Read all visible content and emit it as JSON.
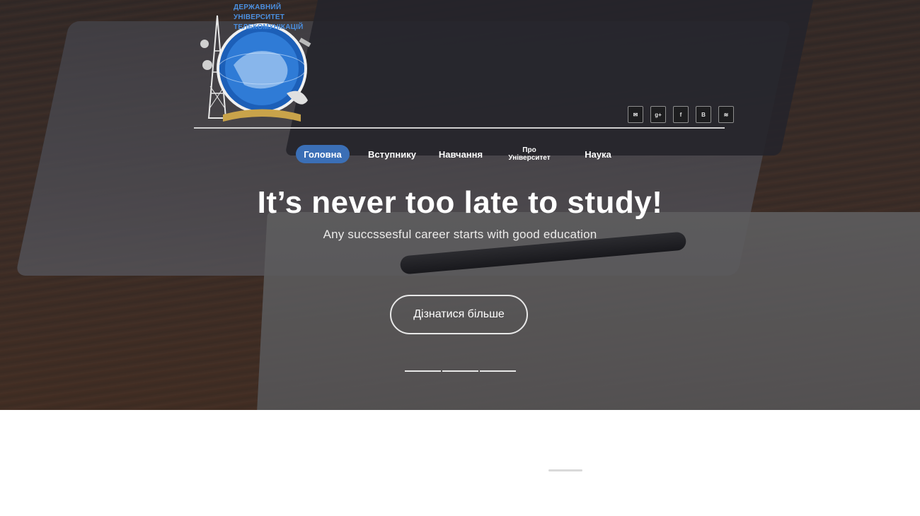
{
  "logo": {
    "lines": [
      "ДЕРЖАВНИЙ",
      "УНІВЕРСИТЕТ",
      "ТЕЛЕКОМУНІКАЦІЙ"
    ]
  },
  "social": [
    {
      "icon": "mail-icon",
      "glyph": "✉"
    },
    {
      "icon": "google-plus-icon",
      "glyph": "g+"
    },
    {
      "icon": "facebook-icon",
      "glyph": "f"
    },
    {
      "icon": "vk-icon",
      "glyph": "B"
    },
    {
      "icon": "rss-icon",
      "glyph": "≋"
    }
  ],
  "nav": {
    "items": [
      {
        "label": "Головна",
        "active": true
      },
      {
        "label": "Вступнику",
        "active": false
      },
      {
        "label": "Навчання",
        "active": false
      },
      {
        "label_line1": "Про",
        "label_line2": "Університет",
        "active": false
      },
      {
        "label": "Наука",
        "active": false
      }
    ]
  },
  "hero": {
    "headline": "It’s never too late to study!",
    "subline": "Any succssesful career starts with good education",
    "cta_label": "Дізнатися більше",
    "slides_count": 3
  },
  "colors": {
    "accent": "#3b6fb6",
    "logo_text": "#4a8fe0"
  }
}
